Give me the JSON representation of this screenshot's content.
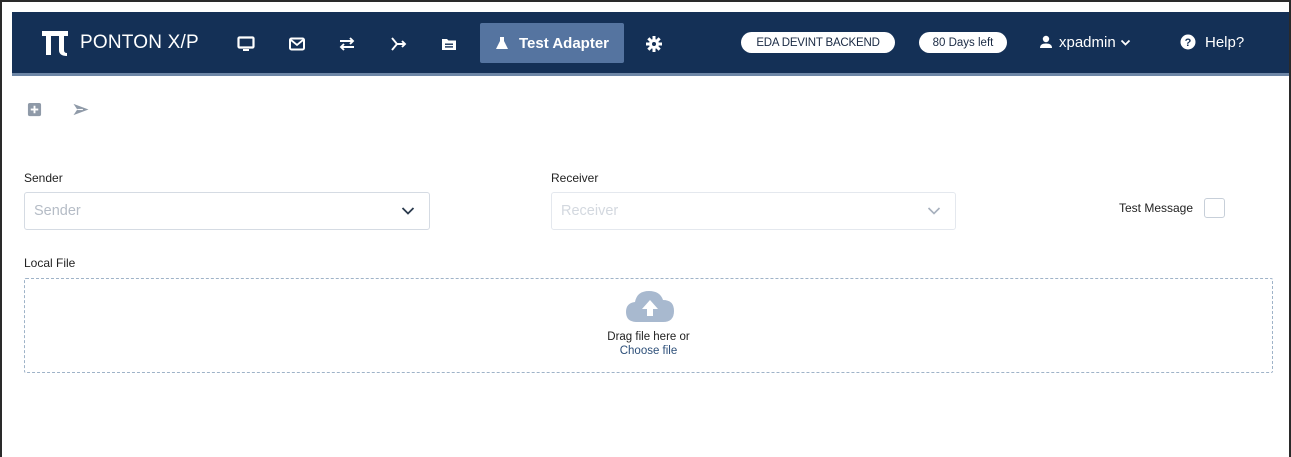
{
  "app": {
    "brand": "PONTON X/P"
  },
  "navbar": {
    "icons": [
      "monitor-icon",
      "mail-icon",
      "transfer-icon",
      "route-icon",
      "folder-icon"
    ],
    "active_tab": "Test Adapter",
    "settings_icon": "gear-icon",
    "environment": "EDA DEVINT BACKEND",
    "license": "80 Days left",
    "user": "xpadmin",
    "help": "Help?"
  },
  "toolbar": {
    "icons": [
      "add-square-icon",
      "send-icon"
    ]
  },
  "form": {
    "sender": {
      "label": "Sender",
      "placeholder": "Sender"
    },
    "receiver": {
      "label": "Receiver",
      "placeholder": "Receiver"
    },
    "test_message": {
      "label": "Test Message",
      "checked": false
    },
    "local_file": {
      "label": "Local File",
      "drop_text": "Drag file here or",
      "choose_link": "Choose file"
    }
  },
  "colors": {
    "navbar_bg": "#143056",
    "active_tab_bg": "#5574a0",
    "navbar_border": "#6d86a6",
    "toolbar_icon": "#8f9aa8",
    "cloud_icon": "#a8b9cf",
    "link": "#2d4f79"
  }
}
